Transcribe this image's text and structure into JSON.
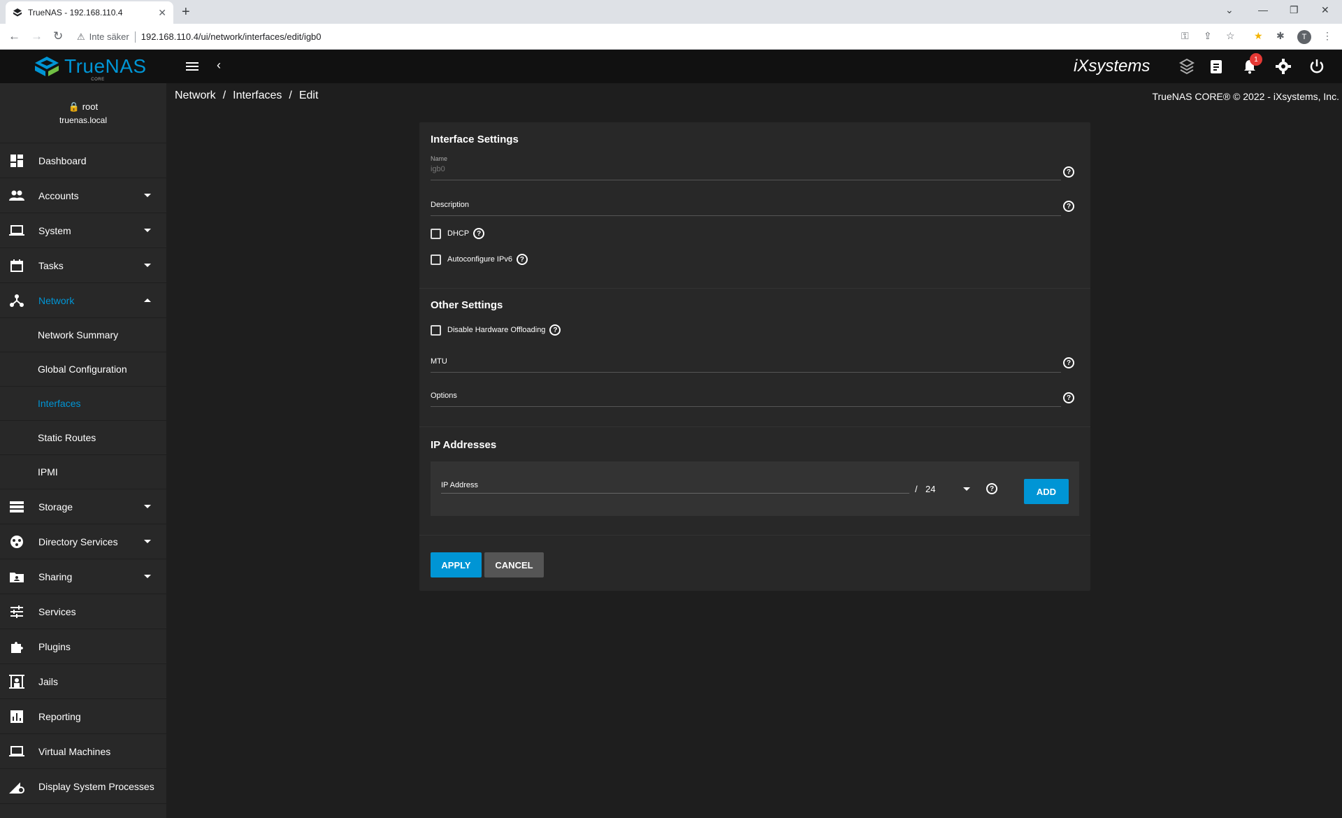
{
  "browser": {
    "tab_title": "TrueNAS - 192.168.110.4",
    "insecure_label": "Inte säker",
    "url": "192.168.110.4/ui/network/interfaces/edit/igb0",
    "profile_initial": "T"
  },
  "app": {
    "logo_text": "TrueNAS",
    "logo_sub": "CORE",
    "vendor": "iXsystems",
    "notification_count": "1",
    "copyright": "TrueNAS CORE® © 2022 - iXsystems, Inc.",
    "accent_color": "#0095d5"
  },
  "user": {
    "name": "root",
    "host": "truenas.local"
  },
  "sidebar": {
    "items": [
      {
        "label": "Dashboard",
        "icon": "dashboard-icon"
      },
      {
        "label": "Accounts",
        "icon": "accounts-icon"
      },
      {
        "label": "System",
        "icon": "laptop-icon"
      },
      {
        "label": "Tasks",
        "icon": "calendar-icon"
      },
      {
        "label": "Network",
        "icon": "network-icon"
      },
      {
        "label": "Storage",
        "icon": "storage-icon"
      },
      {
        "label": "Directory Services",
        "icon": "directory-icon"
      },
      {
        "label": "Sharing",
        "icon": "sharing-icon"
      },
      {
        "label": "Services",
        "icon": "services-icon"
      },
      {
        "label": "Plugins",
        "icon": "puzzle-icon"
      },
      {
        "label": "Jails",
        "icon": "jail-icon"
      },
      {
        "label": "Reporting",
        "icon": "chart-icon"
      },
      {
        "label": "Virtual Machines",
        "icon": "monitor-icon"
      },
      {
        "label": "Display System Processes",
        "icon": "processes-icon"
      }
    ],
    "network_sub": [
      "Network Summary",
      "Global Configuration",
      "Interfaces",
      "Static Routes",
      "IPMI"
    ]
  },
  "breadcrumb": [
    "Network",
    "Interfaces",
    "Edit"
  ],
  "form": {
    "interface_settings_title": "Interface Settings",
    "name_label": "Name",
    "name_value": "igb0",
    "description_label": "Description",
    "dhcp_label": "DHCP",
    "autoconf_label": "Autoconfigure IPv6",
    "other_settings_title": "Other Settings",
    "disable_offload_label": "Disable Hardware Offloading",
    "mtu_label": "MTU",
    "options_label": "Options",
    "ip_title": "IP Addresses",
    "ip_label": "IP Address",
    "slash": "/",
    "netmask": "24",
    "add_label": "ADD",
    "apply_label": "APPLY",
    "cancel_label": "CANCEL"
  }
}
